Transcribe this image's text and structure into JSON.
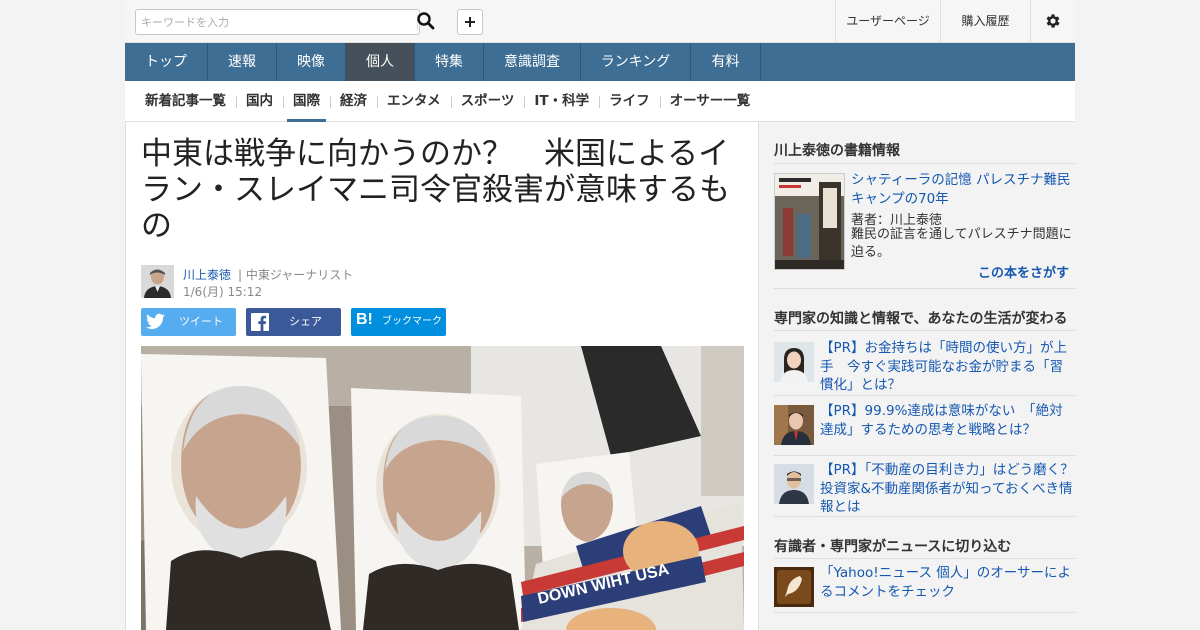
{
  "search": {
    "placeholder": "キーワードを入力"
  },
  "topbar": {
    "user_page": "ユーザーページ",
    "purchase_history": "購入履歴"
  },
  "main_nav": [
    "トップ",
    "速報",
    "映像",
    "個人",
    "特集",
    "意識調査",
    "ランキング",
    "有料"
  ],
  "main_nav_active": "個人",
  "sub_nav": [
    "新着記事一覧",
    "国内",
    "国際",
    "経済",
    "エンタメ",
    "スポーツ",
    "IT・科学",
    "ライフ",
    "オーサー一覧"
  ],
  "sub_nav_active": "国際",
  "article": {
    "title": "中東は戦争に向かうのか？　米国によるイラン・スレイマニ司令官殺害が意味するもの",
    "author": "川上泰徳",
    "author_role": "| 中東ジャーナリスト",
    "date": "1/6(月) 15:12",
    "share": {
      "tweet": "ツイート",
      "facebook": "シェア",
      "bookmark": "ブックマーク"
    },
    "image_banner_text": "DOWN WIHT USA"
  },
  "sidebar": {
    "book_section_title": "川上泰徳の書籍情報",
    "book": {
      "title": "シャティーラの記憶 パレスチナ難民キャンプの70年",
      "author": "著者：川上泰徳",
      "description": "難民の証言を通してパレスチナ問題に迫る。",
      "search_link": "この本をさがす"
    },
    "pr_section_title": "専門家の知識と情報で、あなたの生活が変わる",
    "pr_items": [
      {
        "text": "【PR】お金持ちは「時間の使い方」が上手　今すぐ実践可能なお金が貯まる「習慣化」とは？"
      },
      {
        "text": "【PR】99.9%達成は意味がない　「絶対達成」するための思考と戦略とは？"
      },
      {
        "text": "【PR】「不動産の目利き力」はどう磨く？　投資家&不動産関係者が知っておくべき情報とは"
      }
    ],
    "expert_section_title": "有識者・専門家がニュースに切り込む",
    "expert_item": {
      "text": "「Yahoo!ニュース 個人」のオーサーによるコメントをチェック"
    }
  },
  "colors": {
    "nav_bg": "#3f6e94",
    "nav_active": "#46505a",
    "link": "#1558b0",
    "twitter": "#55acee",
    "facebook": "#3b5998",
    "hatena": "#008fde"
  }
}
